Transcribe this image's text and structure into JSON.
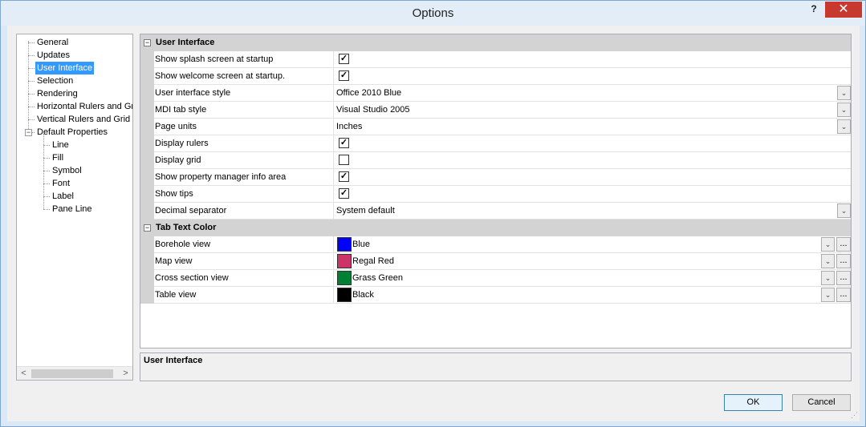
{
  "window": {
    "title": "Options",
    "help_label": "?",
    "close_label": "✕"
  },
  "tree": {
    "items": [
      {
        "label": "General",
        "level": 0
      },
      {
        "label": "Updates",
        "level": 0
      },
      {
        "label": "User Interface",
        "level": 0,
        "selected": true
      },
      {
        "label": "Selection",
        "level": 0
      },
      {
        "label": "Rendering",
        "level": 0
      },
      {
        "label": "Horizontal Rulers and Gri",
        "level": 0
      },
      {
        "label": "Vertical Rulers and Grid",
        "level": 0
      },
      {
        "label": "Default Properties",
        "level": 0,
        "expanded": true
      },
      {
        "label": "Line",
        "level": 1
      },
      {
        "label": "Fill",
        "level": 1
      },
      {
        "label": "Symbol",
        "level": 1
      },
      {
        "label": "Font",
        "level": 1
      },
      {
        "label": "Label",
        "level": 1
      },
      {
        "label": "Pane Line",
        "level": 1
      }
    ],
    "expander_minus": "−",
    "scroll_left": "<",
    "scroll_right": ">"
  },
  "grid": {
    "categories": [
      {
        "label": "User Interface",
        "rows": [
          {
            "name": "Show splash screen at startup",
            "type": "check",
            "checked": true
          },
          {
            "name": "Show welcome screen at startup.",
            "type": "check",
            "checked": true
          },
          {
            "name": "User interface style",
            "type": "dropdown",
            "value": "Office 2010 Blue"
          },
          {
            "name": "MDI tab style",
            "type": "dropdown",
            "value": "Visual Studio 2005"
          },
          {
            "name": "Page units",
            "type": "dropdown",
            "value": "Inches"
          },
          {
            "name": "Display rulers",
            "type": "check",
            "checked": true
          },
          {
            "name": "Display grid",
            "type": "check",
            "checked": false
          },
          {
            "name": "Show property manager info area",
            "type": "check",
            "checked": true
          },
          {
            "name": "Show tips",
            "type": "check",
            "checked": true
          },
          {
            "name": "Decimal separator",
            "type": "dropdown",
            "value": "System default"
          }
        ]
      },
      {
        "label": "Tab Text Color",
        "rows": [
          {
            "name": "Borehole view",
            "type": "color",
            "value": "Blue",
            "color": "#0000ff"
          },
          {
            "name": "Map view",
            "type": "color",
            "value": "Regal Red",
            "color": "#cc3366"
          },
          {
            "name": "Cross section view",
            "type": "color",
            "value": "Grass Green",
            "color": "#008033"
          },
          {
            "name": "Table view",
            "type": "color",
            "value": "Black",
            "color": "#000000"
          }
        ]
      }
    ],
    "check_mark": "✓",
    "dropdown_glyph": "⌄",
    "ellipsis": "...",
    "collapse_glyph": "−"
  },
  "description": {
    "title": "User Interface"
  },
  "buttons": {
    "ok": "OK",
    "cancel": "Cancel"
  }
}
